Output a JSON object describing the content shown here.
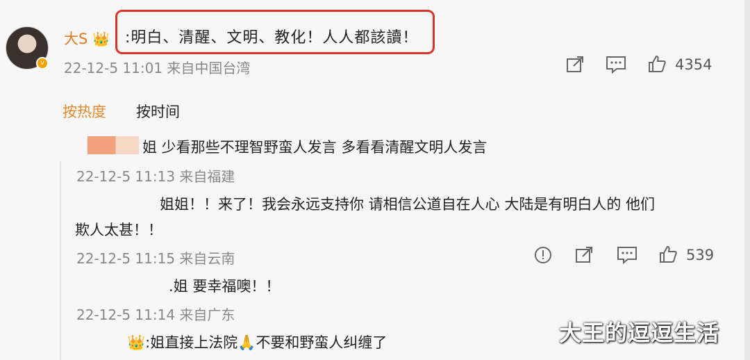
{
  "post": {
    "username": "大S",
    "crown_icon": "👑",
    "text": ":明白、清醒、文明、教化！人人都該讀！",
    "meta": "22-12-5 11:01 来自中国台湾",
    "like_count": "4354"
  },
  "sort": {
    "hot": "按热度",
    "time": "按时间"
  },
  "comments": [
    {
      "text": "姐 少看那些不理智野蛮人发言 多看看清醒文明人发言",
      "meta": "22-12-5 11:13 来自福建"
    },
    {
      "text_line1": "姐姐！！来了！我会永远支持你 请相信公道自在人心 大陆是有明白人的 他们",
      "text_line2": "欺人太甚！！",
      "meta": "22-12-5 11:15 来自云南",
      "like_count": "539"
    },
    {
      "text": ".姐 要幸福噢！！",
      "meta": "22-12-5 11:14 来自广东"
    },
    {
      "text_prefix": ":姐直接上法院",
      "text_suffix": "不要和野蛮人纠缠了",
      "emoji_crown": "👑",
      "emoji_pray": "🙏"
    }
  ],
  "watermark": "大王的逗逗生活",
  "colors": {
    "accent": "#e58a2d",
    "highlight": "#d9362a"
  },
  "icons": [
    "share-icon",
    "comment-icon",
    "like-icon",
    "report-icon"
  ]
}
